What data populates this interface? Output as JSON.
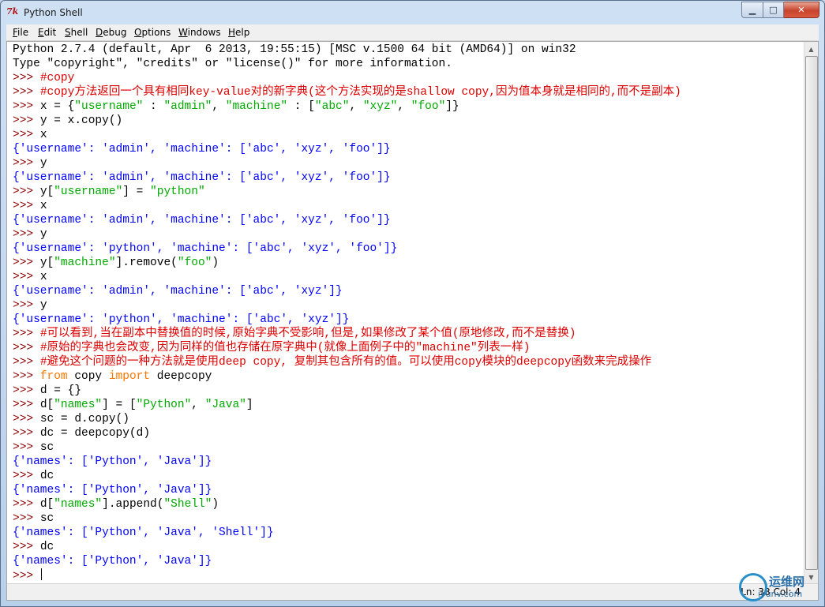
{
  "window": {
    "title": "Python Shell",
    "icon": "tk-feather-icon",
    "buttons": {
      "minimize": "▁",
      "maximize": "□",
      "close": "✕"
    }
  },
  "menu": [
    "File",
    "Edit",
    "Shell",
    "Debug",
    "Options",
    "Windows",
    "Help"
  ],
  "shell": {
    "banner1": "Python 2.7.4 (default, Apr  6 2013, 19:55:15) [MSC v.1500 64 bit (AMD64)] on win32",
    "banner2": "Type \"copyright\", \"credits\" or \"license()\" for more information.",
    "prompt": ">>> ",
    "comment_copy": "#copy",
    "comment_copy_desc": "#copy方法返回一个具有相同key-value对的新字典(这个方法实现的是shallow copy,因为值本身就是相同的,而不是副本)",
    "code_x_assign": "x = {",
    "str_username": "\"username\"",
    "code_colon": " : ",
    "str_admin": "\"admin\"",
    "code_comma": ", ",
    "str_machine": "\"machine\"",
    "code_bracket_open": "[",
    "str_abc": "\"abc\"",
    "str_xyz": "\"xyz\"",
    "str_foo": "\"foo\"",
    "code_close": "]}",
    "code_y_copy": "y = x.copy()",
    "code_x": "x",
    "code_y": "y",
    "res_x1": "{'username': 'admin', 'machine': ['abc', 'xyz', 'foo']}",
    "res_y1": "{'username': 'admin', 'machine': ['abc', 'xyz', 'foo']}",
    "code_y_open": "y[",
    "code_set_eq": "] = ",
    "str_python": "\"python\"",
    "res_x2": "{'username': 'admin', 'machine': ['abc', 'xyz', 'foo']}",
    "res_y2": "{'username': 'python', 'machine': ['abc', 'xyz', 'foo']}",
    "code_remove": "].remove(",
    "code_paren_close": ")",
    "res_x3": "{'username': 'admin', 'machine': ['abc', 'xyz']}",
    "res_y3": "{'username': 'python', 'machine': ['abc', 'xyz']}",
    "comment_a": "#可以看到,当在副本中替换值的时候,原始字典不受影响,但是,如果修改了某个值(原地修改,而不是替换)",
    "comment_b": "#原始的字典也会改变,因为同样的值也存储在原字典中(就像上面例子中的\"machine\"列表一样)",
    "comment_c": "#避免这个问题的一种方法就是使用deep copy, 复制其包含所有的值。可以使用copy模块的deepcopy函数来完成操作",
    "kw_from": "from",
    "code_copy_mod": " copy ",
    "kw_import": "import",
    "code_deepcopy": " deepcopy",
    "code_d_empty": "d = {}",
    "code_d_open": "d[",
    "str_names": "\"names\"",
    "code_list_open": "] = [",
    "str_Python": "\"Python\"",
    "str_Java": "\"Java\"",
    "code_list_close": "]",
    "code_sc_copy": "sc = d.copy()",
    "code_dc_deepcopy": "dc = deepcopy(d)",
    "code_sc": "sc",
    "code_dc": "dc",
    "res_sc1": "{'names': ['Python', 'Java']}",
    "res_dc1": "{'names': ['Python', 'Java']}",
    "code_append": "].append(",
    "str_Shell": "\"Shell\"",
    "res_sc2": "{'names': ['Python', 'Java', 'Shell']}",
    "res_dc2": "{'names': ['Python', 'Java']}"
  },
  "status": {
    "position": "Ln: 38 Col: 4"
  },
  "watermark": {
    "text": "运维网",
    "sub": "iyunv.com"
  },
  "colors": {
    "prompt": "#8b0000",
    "comment": "#dd0000",
    "string": "#00aa00",
    "keyword": "#ff7700",
    "result": "#0000ff"
  }
}
